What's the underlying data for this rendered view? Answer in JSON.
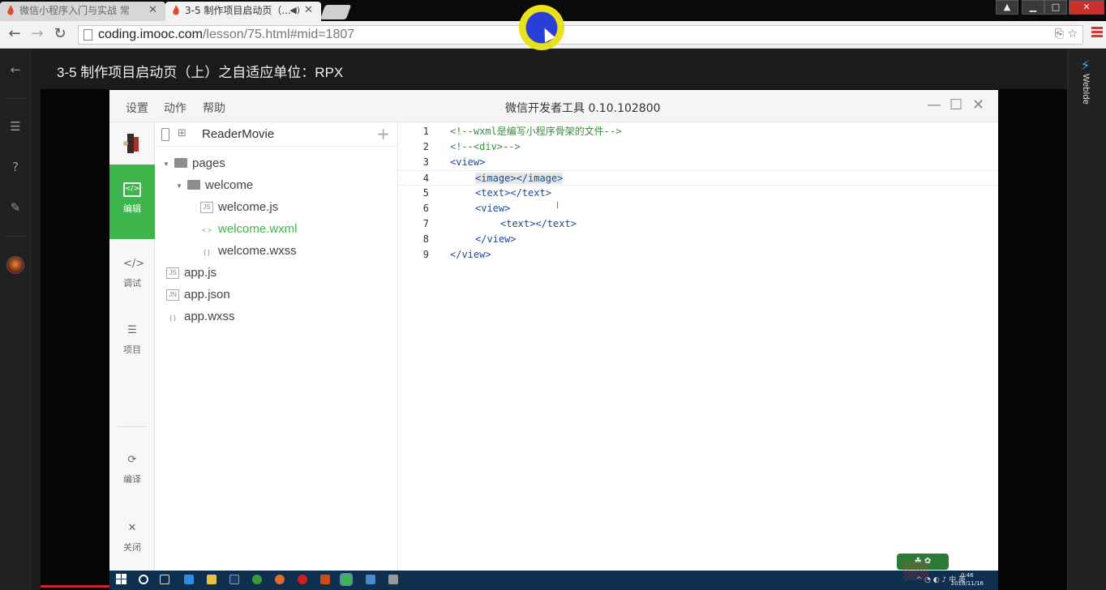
{
  "browser": {
    "tabs": [
      {
        "title": "微信小程序入门与实战 常",
        "active": false
      },
      {
        "title": "3-5 制作项目启动页（...",
        "active": true
      }
    ],
    "url_host": "coding.imooc.com",
    "url_path": "/lesson/75.html#mid=1807"
  },
  "page": {
    "lesson_title": "3-5 制作项目启动页（上）之自适应单位：RPX",
    "right_rail_label": "WebIde"
  },
  "devtool": {
    "menus": [
      "设置",
      "动作",
      "帮助"
    ],
    "title": "微信开发者工具 0.10.102800",
    "sidebar": [
      {
        "label": "编辑",
        "icon": "edit-code-icon",
        "active": true
      },
      {
        "label": "调试",
        "icon": "debug-code-icon",
        "active": false
      },
      {
        "label": "项目",
        "icon": "project-list-icon",
        "active": false
      },
      {
        "label": "编译",
        "icon": "compile-icon",
        "active": false
      },
      {
        "label": "关闭",
        "icon": "close-icon",
        "active": false
      }
    ],
    "project_name": "ReaderMovie",
    "tree": [
      {
        "label": "pages",
        "type": "folder",
        "depth": 0
      },
      {
        "label": "welcome",
        "type": "folder",
        "depth": 1
      },
      {
        "label": "welcome.js",
        "type": "js",
        "depth": 2
      },
      {
        "label": "welcome.wxml",
        "type": "wxml",
        "depth": 2,
        "active": true
      },
      {
        "label": "welcome.wxss",
        "type": "wxss",
        "depth": 2
      },
      {
        "label": "app.js",
        "type": "js",
        "depth": 0
      },
      {
        "label": "app.json",
        "type": "json",
        "depth": 0
      },
      {
        "label": "app.wxss",
        "type": "wxss",
        "depth": 0
      }
    ],
    "code_lines": [
      {
        "n": "1",
        "text": "<!--wxml是编写小程序骨架的文件-->"
      },
      {
        "n": "2",
        "text": "<!--<div>-->"
      },
      {
        "n": "3",
        "text": "<view>"
      },
      {
        "n": "4",
        "text": "<image></image>"
      },
      {
        "n": "5",
        "text": "<text></text>"
      },
      {
        "n": "6",
        "text": "<view>"
      },
      {
        "n": "7",
        "text": "<text></text>"
      },
      {
        "n": "8",
        "text": "</view>"
      },
      {
        "n": "9",
        "text": "</view>"
      }
    ]
  },
  "taskbar": {
    "tray_text": "中 英",
    "clock_time": "0:46",
    "clock_date": "2016/11/16"
  }
}
